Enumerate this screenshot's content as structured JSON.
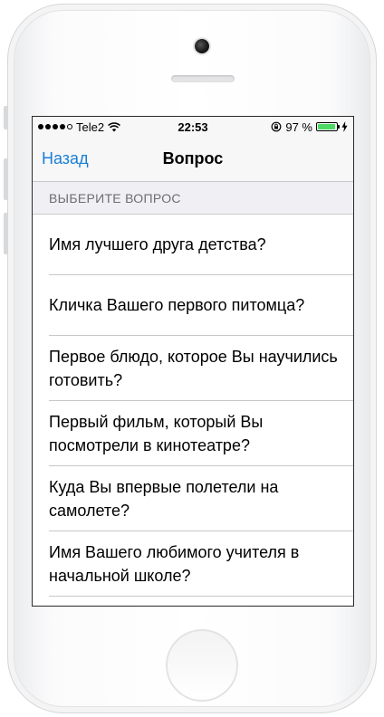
{
  "status_bar": {
    "carrier": "Tele2",
    "time": "22:53",
    "battery_percent": "97 %",
    "battery_level": 0.97,
    "battery_color": "#4cd964"
  },
  "nav": {
    "back_label": "Назад",
    "title": "Вопрос"
  },
  "section": {
    "header": "ВЫБЕРИТЕ ВОПРОС"
  },
  "questions": [
    {
      "label": "Имя лучшего друга детства?"
    },
    {
      "label": "Кличка Вашего первого питомца?"
    },
    {
      "label": "Первое блюдо, которое Вы научились готовить?"
    },
    {
      "label": "Первый фильм, который Вы посмотрели в кинотеатре?"
    },
    {
      "label": "Куда Вы впервые полетели на самолете?"
    },
    {
      "label": "Имя Вашего любимого учителя в начальной школе?"
    }
  ],
  "colors": {
    "accent": "#1a7ed6",
    "section_bg": "#efeff4",
    "separator": "#c8c7cc"
  },
  "icons": [
    "signal-dots-icon",
    "wifi-icon",
    "rotation-lock-icon",
    "battery-icon",
    "charging-bolt-icon"
  ]
}
